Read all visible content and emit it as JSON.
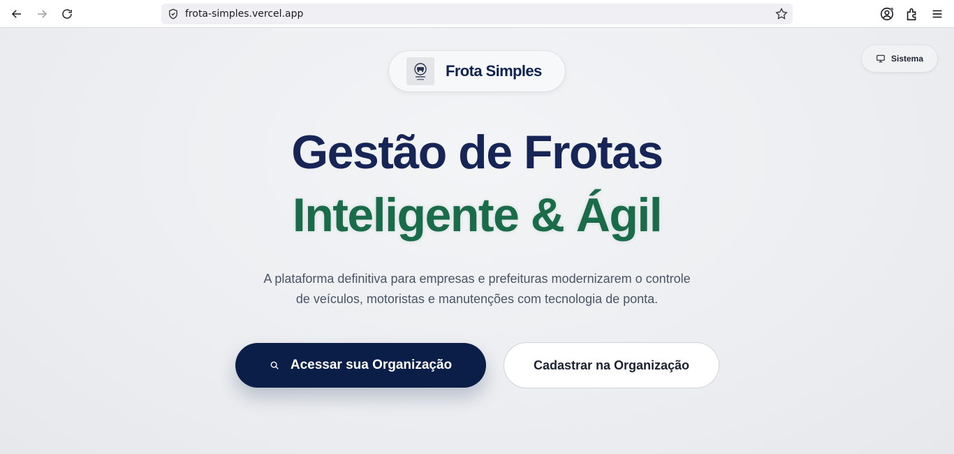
{
  "browser": {
    "url": "frota-simples.vercel.app",
    "icons": [
      "back-icon",
      "forward-icon",
      "reload-icon",
      "shield-icon",
      "star-icon",
      "account-icon",
      "extensions-icon",
      "menu-icon"
    ]
  },
  "header": {
    "brand_name": "Frota Simples",
    "theme_toggle_label": "Sistema"
  },
  "hero": {
    "headline_line1": "Gestão de Frotas",
    "headline_line2": "Inteligente & Ágil",
    "subtitle_line1": "A plataforma definitiva para empresas e prefeituras modernizarem o controle",
    "subtitle_line2": "de veículos, motoristas e manutenções com tecnologia de ponta.",
    "primary_button": "Acessar sua Organização",
    "secondary_button": "Cadastrar na Organização"
  },
  "colors": {
    "navy": "#172556",
    "green": "#1a6b4a",
    "button_dark": "#0a1e48"
  }
}
